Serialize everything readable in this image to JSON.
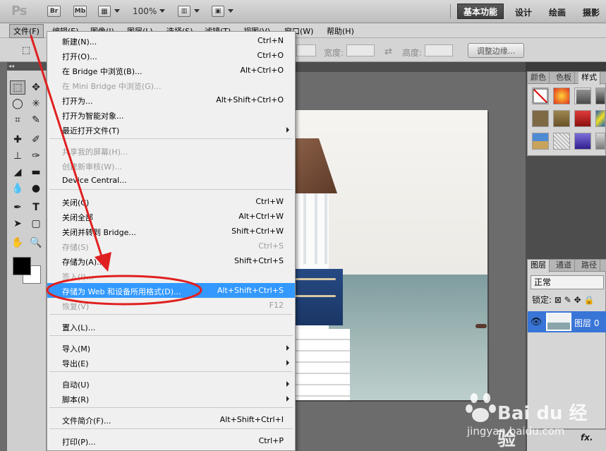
{
  "app": {
    "logo": "Ps",
    "bridge_btn": "Br",
    "mini_bridge_btn": "Mb",
    "zoom": "100%",
    "workspace_active": "基本功能",
    "workspace_items": [
      "设计",
      "绘画",
      "摄影"
    ]
  },
  "menubar": {
    "items": [
      "文件(F)",
      "编辑(E)",
      "图像(I)",
      "图层(L)",
      "选择(S)",
      "滤镜(T)",
      "视图(V)",
      "窗口(W)",
      "帮助(H)"
    ]
  },
  "options": {
    "width_label": "宽度:",
    "height_label": "高度:",
    "refine_edge": "调整边缘..."
  },
  "file_menu": {
    "items": [
      {
        "label": "新建(N)...",
        "shortcut": "Ctrl+N"
      },
      {
        "label": "打开(O)...",
        "shortcut": "Ctrl+O"
      },
      {
        "label": "在 Bridge 中浏览(B)...",
        "shortcut": "Alt+Ctrl+O"
      },
      {
        "label": "在 Mini Bridge 中浏览(G)...",
        "shortcut": "",
        "disabled": true
      },
      {
        "label": "打开为...",
        "shortcut": "Alt+Shift+Ctrl+O"
      },
      {
        "label": "打开为智能对象...",
        "shortcut": ""
      },
      {
        "label": "最近打开文件(T)",
        "shortcut": "",
        "submenu": true
      },
      {
        "label": "共享我的屏幕(H)...",
        "shortcut": "",
        "disabled": true
      },
      {
        "label": "创建新审核(W)...",
        "shortcut": "",
        "disabled": true
      },
      {
        "label": "Device Central...",
        "shortcut": ""
      },
      {
        "label": "关闭(C)",
        "shortcut": "Ctrl+W"
      },
      {
        "label": "关闭全部",
        "shortcut": "Alt+Ctrl+W"
      },
      {
        "label": "关闭并转到 Bridge...",
        "shortcut": "Shift+Ctrl+W"
      },
      {
        "label": "存储(S)",
        "shortcut": "Ctrl+S",
        "disabled": true
      },
      {
        "label": "存储为(A)...",
        "shortcut": "Shift+Ctrl+S"
      },
      {
        "label": "签入(I)...",
        "shortcut": "",
        "disabled": true
      },
      {
        "label": "存储为 Web 和设备所用格式(D)...",
        "shortcut": "Alt+Shift+Ctrl+S",
        "highlighted": true
      },
      {
        "label": "恢复(V)",
        "shortcut": "F12",
        "disabled": true
      },
      {
        "label": "置入(L)...",
        "shortcut": ""
      },
      {
        "label": "导入(M)",
        "shortcut": "",
        "submenu": true
      },
      {
        "label": "导出(E)",
        "shortcut": "",
        "submenu": true
      },
      {
        "label": "自动(U)",
        "shortcut": "",
        "submenu": true
      },
      {
        "label": "脚本(R)",
        "shortcut": "",
        "submenu": true
      },
      {
        "label": "文件简介(F)...",
        "shortcut": "Alt+Shift+Ctrl+I"
      },
      {
        "label": "打印(P)...",
        "shortcut": "Ctrl+P"
      }
    ]
  },
  "panels": {
    "top_tabs": [
      "颜色",
      "色板",
      "样式"
    ],
    "layers_tabs": [
      "图层",
      "通道",
      "路径"
    ],
    "blend_mode": "正常",
    "lock_label": "锁定:",
    "layer_name": "图层 0",
    "fx": "fx."
  },
  "watermark": {
    "brand": "Bai du 经验",
    "url": "jingyan.baidu.com"
  },
  "colors": {
    "accent": "#3399ff",
    "annotation": "#e02020"
  }
}
